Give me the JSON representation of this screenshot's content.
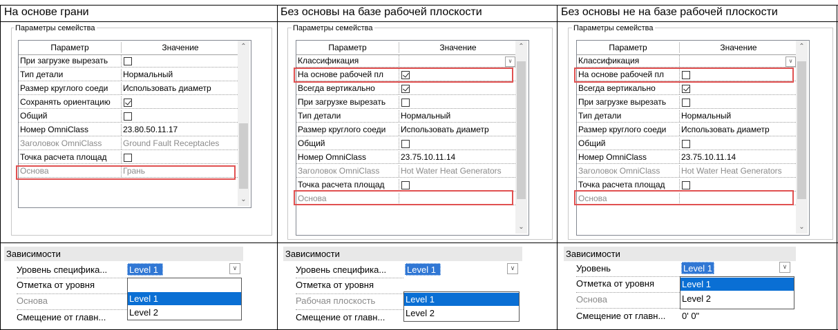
{
  "columns": [
    {
      "caption": "На основе грани"
    },
    {
      "caption": "Без основы на базе рабочей плоскости"
    },
    {
      "caption": "Без основы не на базе рабочей плоскости"
    }
  ],
  "family_params": {
    "group_title": "Параметры семейства",
    "header_param": "Параметр",
    "header_value": "Значение",
    "col1": [
      {
        "k": "При загрузке вырезать",
        "v": "",
        "cb": "off"
      },
      {
        "k": "Тип детали",
        "v": "Нормальный"
      },
      {
        "k": "Размер круглого соеди",
        "v": "Использовать диаметр"
      },
      {
        "k": "Сохранять ориентацию",
        "v": "",
        "cb": "on"
      },
      {
        "k": "Общий",
        "v": "",
        "cb": "off"
      },
      {
        "k": "Номер OmniClass",
        "v": "23.80.50.11.17"
      },
      {
        "k": "Заголовок OmniClass",
        "v": "Ground Fault Receptacles",
        "gray": true
      },
      {
        "k": "Точка расчета площад",
        "v": "",
        "cb": "off"
      },
      {
        "k": "Основа",
        "v": "Грань",
        "gray": true
      }
    ],
    "col2": [
      {
        "k": "Классификация",
        "v": "",
        "dd": true
      },
      {
        "k": "На основе рабочей пл",
        "v": "",
        "cb": "on"
      },
      {
        "k": "Всегда вертикально",
        "v": "",
        "cb": "on"
      },
      {
        "k": "При загрузке вырезать",
        "v": "",
        "cb": "off"
      },
      {
        "k": "Тип детали",
        "v": "Нормальный"
      },
      {
        "k": "Размер круглого соеди",
        "v": "Использовать диаметр"
      },
      {
        "k": "Общий",
        "v": "",
        "cb": "off"
      },
      {
        "k": "Номер OmniClass",
        "v": "23.75.10.11.14"
      },
      {
        "k": "Заголовок OmniClass",
        "v": "Hot Water Heat Generators",
        "gray": true
      },
      {
        "k": "Точка расчета площад",
        "v": "",
        "cb": "off"
      },
      {
        "k": "Основа",
        "v": "",
        "gray": true
      }
    ],
    "col3": [
      {
        "k": "Классификация",
        "v": "",
        "dd": true
      },
      {
        "k": "На основе рабочей пл",
        "v": "",
        "cb": "off"
      },
      {
        "k": "Всегда вертикально",
        "v": "",
        "cb": "on"
      },
      {
        "k": "При загрузке вырезать",
        "v": "",
        "cb": "off"
      },
      {
        "k": "Тип детали",
        "v": "Нормальный"
      },
      {
        "k": "Размер круглого соеди",
        "v": "Использовать диаметр"
      },
      {
        "k": "Общий",
        "v": "",
        "cb": "off"
      },
      {
        "k": "Номер OmniClass",
        "v": "23.75.10.11.14"
      },
      {
        "k": "Заголовок OmniClass",
        "v": "Hot Water Heat Generators",
        "gray": true
      },
      {
        "k": "Точка расчета площад",
        "v": "",
        "cb": "off"
      },
      {
        "k": "Основа",
        "v": "",
        "gray": true
      }
    ]
  },
  "constraints": {
    "head": "Зависимости",
    "col1": {
      "level_label": "Уровень специфика...",
      "level_value": "Level 1",
      "offset_label": "Отметка от уровня",
      "host_label": "Основа",
      "shift_label": "Смещение от главн...",
      "options": [
        "Level 1",
        "Level 2"
      ]
    },
    "col2": {
      "level_label": "Уровень специфика...",
      "level_value": "Level 1",
      "offset_label": "Отметка от уровня",
      "host_label": "Рабочая плоскость",
      "shift_label": "Смещение от главн...",
      "options": [
        "Level 1",
        "Level 2"
      ]
    },
    "col3": {
      "level_label": "Уровень",
      "level_value": "Level 1",
      "offset_label": "Отметка от уровня",
      "host_label": "Основа",
      "shift_label": "Смещение от главн...",
      "shift_value": "0'  0\"",
      "options": [
        "Level 1",
        "Level 2"
      ]
    }
  }
}
